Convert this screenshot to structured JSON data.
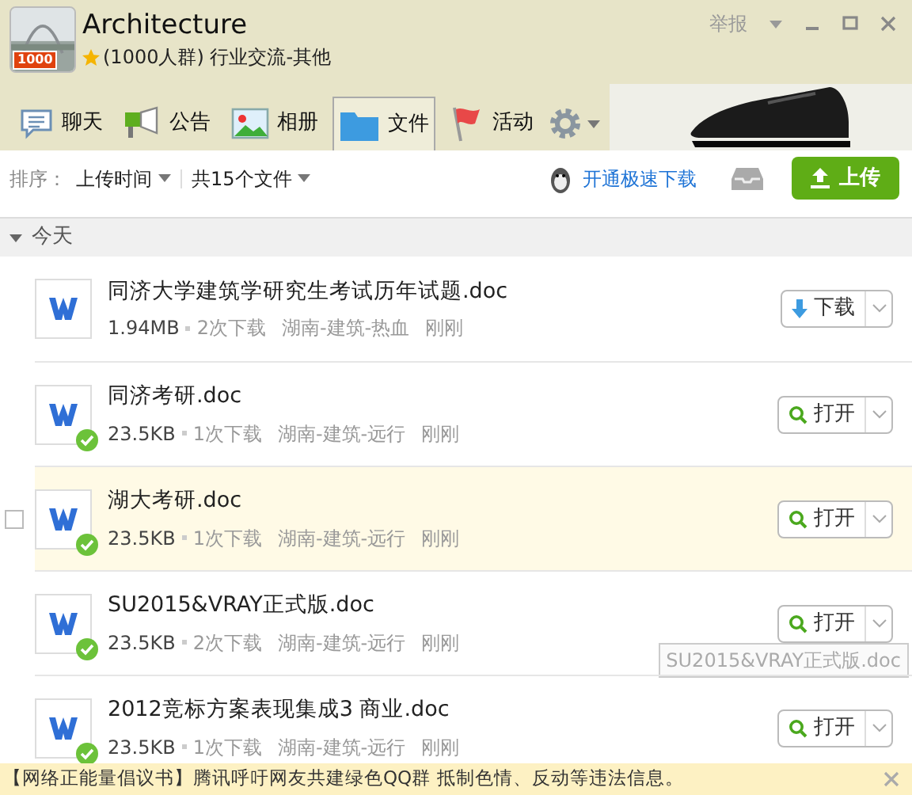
{
  "window": {
    "title": "Architecture",
    "avatar_badge": "1000",
    "subtitle": "(1000人群) 行业交流-其他",
    "report": "举报"
  },
  "tabs": [
    {
      "kind": "chat",
      "label": "聊天",
      "selected": false
    },
    {
      "kind": "notice",
      "label": "公告",
      "selected": false
    },
    {
      "kind": "album",
      "label": "相册",
      "selected": false
    },
    {
      "kind": "files",
      "label": "文件",
      "selected": true
    },
    {
      "kind": "event",
      "label": "活动",
      "selected": false
    }
  ],
  "toolbar": {
    "sort_label": "排序：",
    "sort_value": "上传时间",
    "file_count": "共15个文件",
    "speed_link": "开通极速下载",
    "upload": "上传"
  },
  "section": {
    "label": "今天",
    "expanded": true
  },
  "files": [
    {
      "name": "同济大学建筑学研究生考试历年试题.doc",
      "size": "1.94MB",
      "downloads": "2次下载",
      "uploader": "湖南-建筑-热血",
      "time": "刚刚",
      "downloaded": false,
      "highlighted": false,
      "action": {
        "kind": "download",
        "label": "下载"
      }
    },
    {
      "name": "同济考研.doc",
      "size": "23.5KB",
      "downloads": "1次下载",
      "uploader": "湖南-建筑-远行",
      "time": "刚刚",
      "downloaded": true,
      "highlighted": false,
      "action": {
        "kind": "open",
        "label": "打开"
      }
    },
    {
      "name": "湖大考研.doc",
      "size": "23.5KB",
      "downloads": "1次下载",
      "uploader": "湖南-建筑-远行",
      "time": "刚刚",
      "downloaded": true,
      "highlighted": true,
      "checked": false,
      "action": {
        "kind": "open",
        "label": "打开"
      }
    },
    {
      "name": "SU2015&VRAY正式版.doc",
      "size": "23.5KB",
      "downloads": "2次下载",
      "uploader": "湖南-建筑-远行",
      "time": "刚刚",
      "downloaded": true,
      "highlighted": false,
      "action": {
        "kind": "open",
        "label": "打开"
      },
      "tooltip": "SU2015&VRAY正式版.doc"
    },
    {
      "name": "2012竞标方案表现集成3 商业.doc",
      "size": "23.5KB",
      "downloads": "1次下载",
      "uploader": "湖南-建筑-远行",
      "time": "刚刚",
      "downloaded": true,
      "highlighted": false,
      "action": {
        "kind": "open",
        "label": "打开"
      }
    }
  ],
  "notice_bar": {
    "text": "【网络正能量倡议书】腾讯呼吁网友共建绿色QQ群 抵制色情、反动等违法信息。"
  }
}
